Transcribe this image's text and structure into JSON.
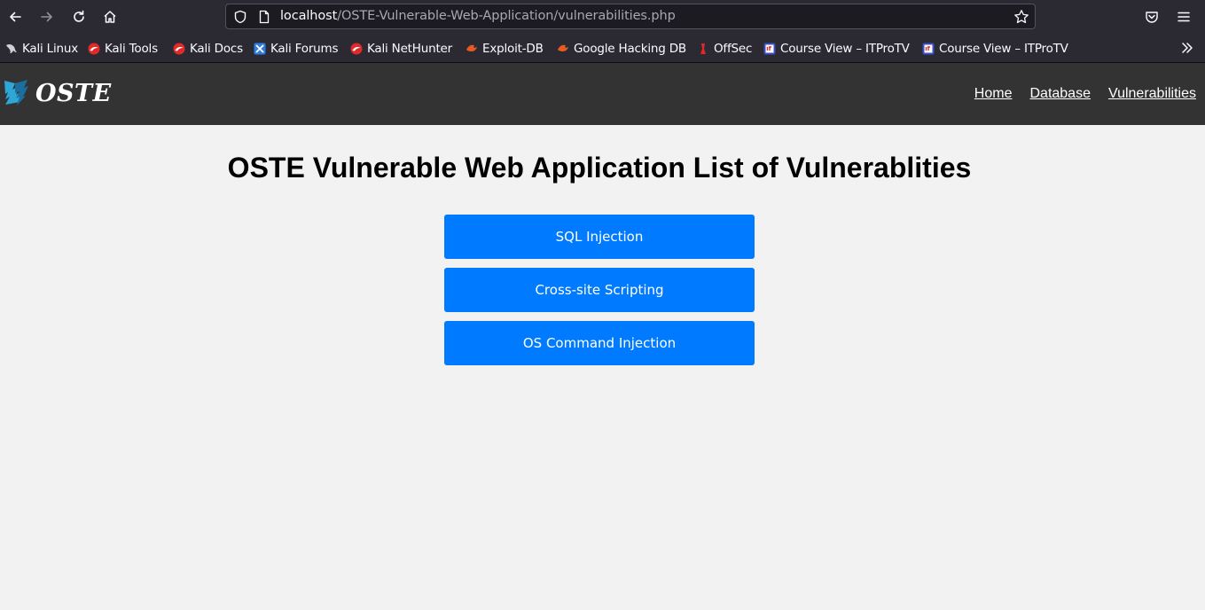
{
  "browser": {
    "url_host": "localhost",
    "url_path": "/OSTE-Vulnerable-Web-Application/vulnerabilities.php",
    "bookmarks": [
      {
        "label": "Kali Linux",
        "icon": "kali-dragon-icon"
      },
      {
        "label": "Kali Tools",
        "icon": "kali-icon"
      },
      {
        "label": "Kali Docs",
        "icon": "kali-icon"
      },
      {
        "label": "Kali Forums",
        "icon": "kali-forums-icon"
      },
      {
        "label": "Kali NetHunter",
        "icon": "kali-icon"
      },
      {
        "label": "Exploit-DB",
        "icon": "exploit-db-icon"
      },
      {
        "label": "Google Hacking DB",
        "icon": "exploit-db-icon"
      },
      {
        "label": "OffSec",
        "icon": "offsec-icon"
      },
      {
        "label": "Course View – ITProTV",
        "icon": "itprotv-icon"
      },
      {
        "label": "Course View – ITProTV",
        "icon": "itprotv-icon"
      }
    ]
  },
  "site": {
    "logo_text": "OSTE",
    "nav": [
      "Home",
      "Database",
      "Vulnerabilities"
    ]
  },
  "main": {
    "title": "OSTE Vulnerable Web Application List of Vulnerablities",
    "buttons": [
      "SQL Injection",
      "Cross-site Scripting",
      "OS Command Injection"
    ]
  },
  "colors": {
    "header_bg": "#333333",
    "button_bg": "#007bff",
    "page_bg": "#f2f2f2"
  }
}
